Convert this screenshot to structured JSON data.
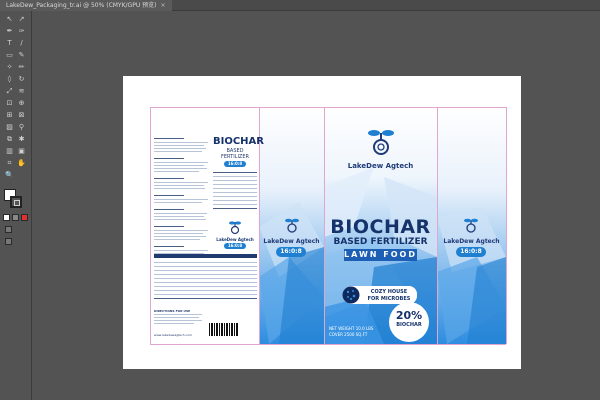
{
  "tab": {
    "title": "LakeDew_Packaging_tr.ai @ 50% (CMYK/GPU 预览)",
    "close": "×"
  },
  "tools": [
    "selection-icon",
    "direct-selection-icon",
    "pen-icon",
    "curvature-icon",
    "type-icon",
    "line-icon",
    "rectangle-icon",
    "paintbrush-icon",
    "shaper-icon",
    "pencil-icon",
    "eraser-icon",
    "rotate-icon",
    "scale-icon",
    "width-icon",
    "free-transform-icon",
    "shape-builder-icon",
    "perspective-icon",
    "mesh-icon",
    "gradient-icon",
    "eyedropper-icon",
    "blend-icon",
    "symbol-sprayer-icon",
    "column-graph-icon",
    "artboard-icon",
    "slice-icon",
    "hand-icon",
    "zoom-icon"
  ],
  "tool_glyphs": [
    "↖",
    "↗",
    "✒",
    "✑",
    "T",
    "∕",
    "▭",
    "✎",
    "✧",
    "✏",
    "◊",
    "↻",
    "⤢",
    "≋",
    "⊡",
    "⊕",
    "⊞",
    "⊠",
    "▨",
    "⚲",
    "⧉",
    "✱",
    "▥",
    "▣",
    "⌗",
    "✋",
    "🔍"
  ],
  "colors": {
    "accent_blue": "#1f7fd0",
    "navy": "#15326b",
    "guide": "#e0a6cf"
  },
  "package": {
    "brand": "LakeDew Agtech",
    "title": "BIOCHAR",
    "subtitle": "BASED FERTILIZER",
    "product_line": "LAWN FOOD",
    "ratio": "16:0:8",
    "cozy_line1": "COZY HOUSE",
    "cozy_line2": "FOR MICROBES",
    "net_weight_line1": "NET WEIGHT 10.0 LBS",
    "net_weight_line2": "COVER 2500 SQ.FT",
    "percent": "20%",
    "percent_label": "BIOCHAR",
    "side_title": "BIOCHAR",
    "side_subtitle": "BASED",
    "side_subtitle2": "FERTILIZER",
    "side_ratio": "16:0:8",
    "directions_title": "DIRECTIONS FOR USE",
    "website": "www.lakedewagtech.com"
  }
}
